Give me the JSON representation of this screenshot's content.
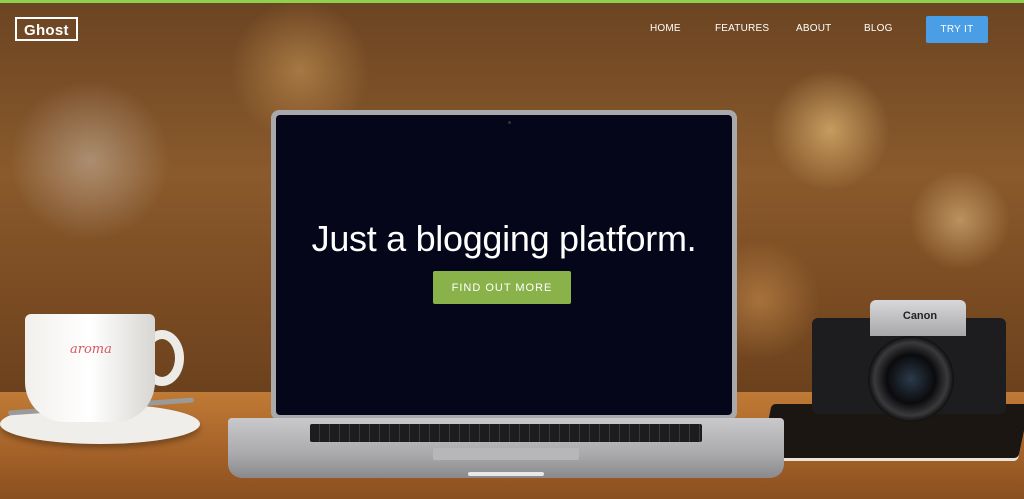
{
  "brand": {
    "logo_text": "Ghost"
  },
  "nav": {
    "items": [
      {
        "label": "HOME"
      },
      {
        "label": "FEATURES"
      },
      {
        "label": "ABOUT"
      },
      {
        "label": "BLOG"
      }
    ],
    "cta_label": "TRY IT"
  },
  "hero": {
    "headline": "Just a blogging platform.",
    "cta_label": "FIND OUT MORE"
  },
  "scene": {
    "cup_brand": "aroma",
    "camera_brand": "Canon"
  },
  "colors": {
    "accent_top_bar": "#8fd14f",
    "try_button": "#4a9ee6",
    "cta_button": "#8ab24b"
  }
}
